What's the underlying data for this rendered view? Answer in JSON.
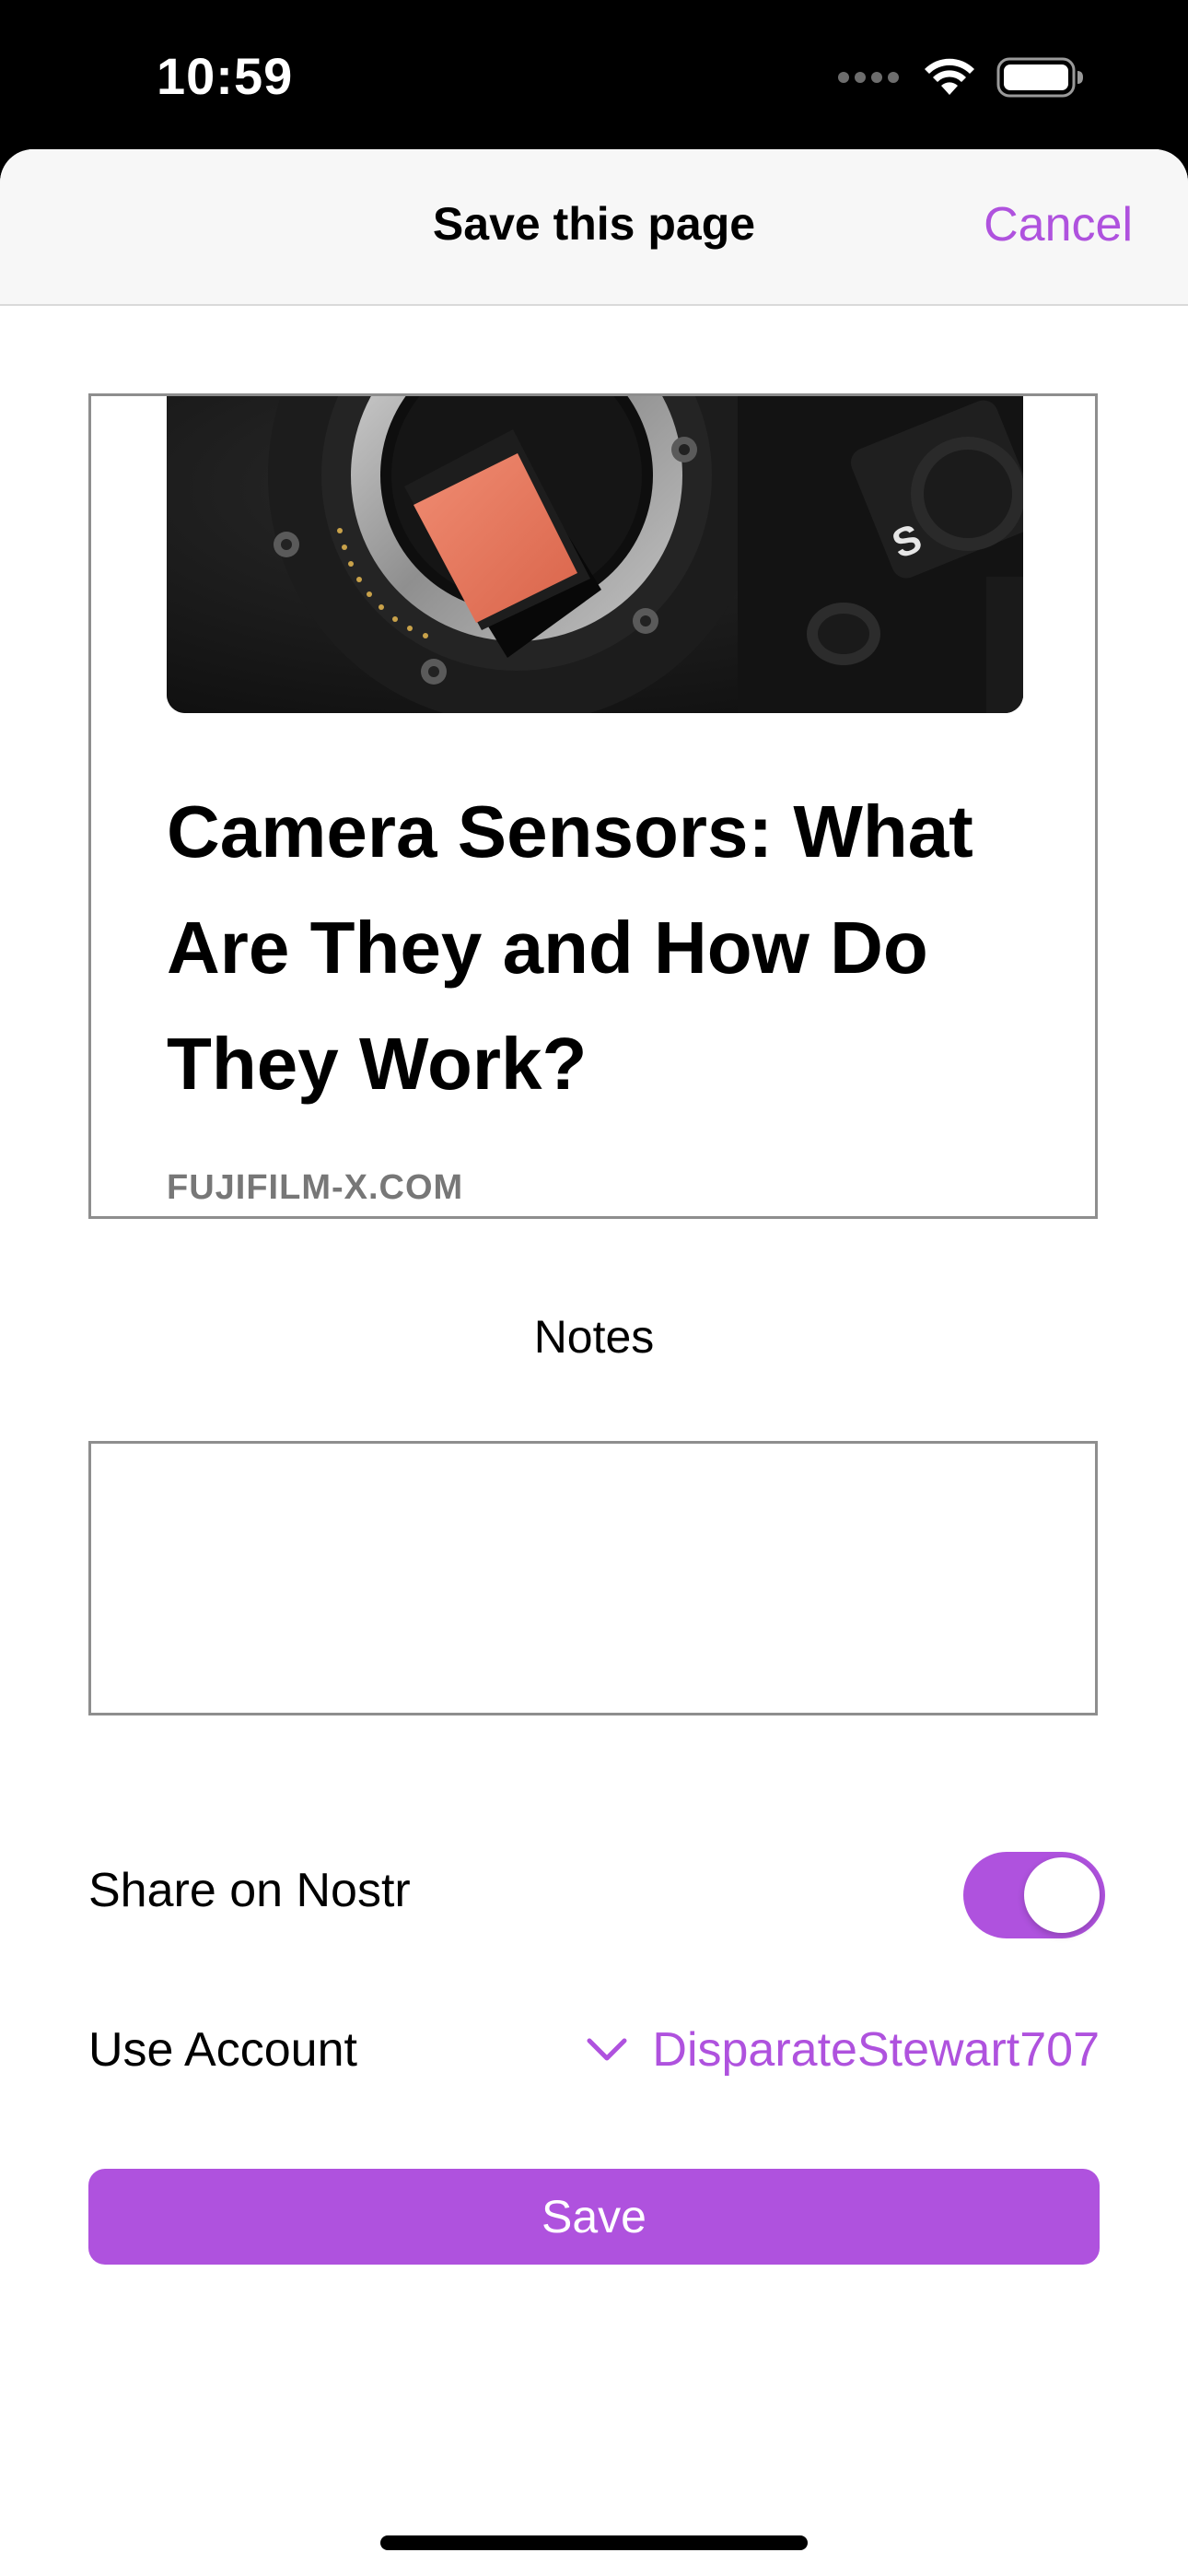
{
  "status_bar": {
    "time": "10:59"
  },
  "nav": {
    "title": "Save this page",
    "cancel_label": "Cancel"
  },
  "preview": {
    "title": "Camera Sensors: What Are They and How Do They Work?",
    "domain": "FUJIFILM-X.COM"
  },
  "notes": {
    "label": "Notes",
    "value": ""
  },
  "share": {
    "label": "Share on Nostr",
    "enabled": true
  },
  "account": {
    "label": "Use Account",
    "value": "DisparateStewart707"
  },
  "save_label": "Save",
  "colors": {
    "accent": "#af52de",
    "border": "#8e8e8e",
    "domain_text": "#777777",
    "nav_background": "#f7f7f7"
  },
  "icons": [
    "signal-icon",
    "wifi-icon",
    "battery-icon",
    "chevron-down-icon"
  ]
}
